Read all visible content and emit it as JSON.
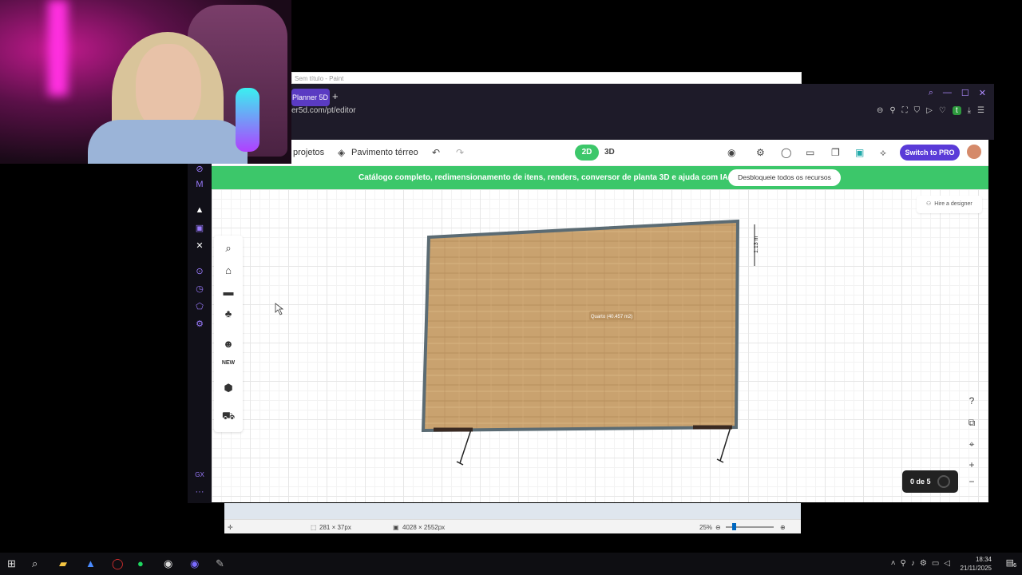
{
  "paint": {
    "title": "Sem título - Paint"
  },
  "browser": {
    "tab_label": "Planner 5D",
    "new_tab": "+",
    "url": "er5d.com/pt/editor",
    "profile_letter": "t"
  },
  "toolbar": {
    "projects_label": "projetos",
    "floor_label": "Pavimento térreo",
    "mode_2d": "2D",
    "mode_3d": "3D",
    "pro_label": "Switch to PRO"
  },
  "banner": {
    "text": "Catálogo completo, redimensionamento de itens, renders, conversor de planta 3D e ajuda com IA",
    "button": "Desbloqueie todos os recursos"
  },
  "canvas": {
    "hire_label": "Hire a designer",
    "room_label": "Quarto (40.457 m2)",
    "dimension_label": "1.13 m",
    "progress_label": "0 de 5"
  },
  "statusbar": {
    "selection": "281 × 37px",
    "image_size": "4028 × 2552px",
    "zoom": "25%"
  },
  "taskbar": {
    "time": "18:34",
    "date": "21/11/2025",
    "notifications": "6"
  },
  "colors": {
    "accent_purple": "#5a3bd8",
    "banner_green": "#3cc76a",
    "wall": "#5b6b73",
    "floor": "#c8a170"
  }
}
